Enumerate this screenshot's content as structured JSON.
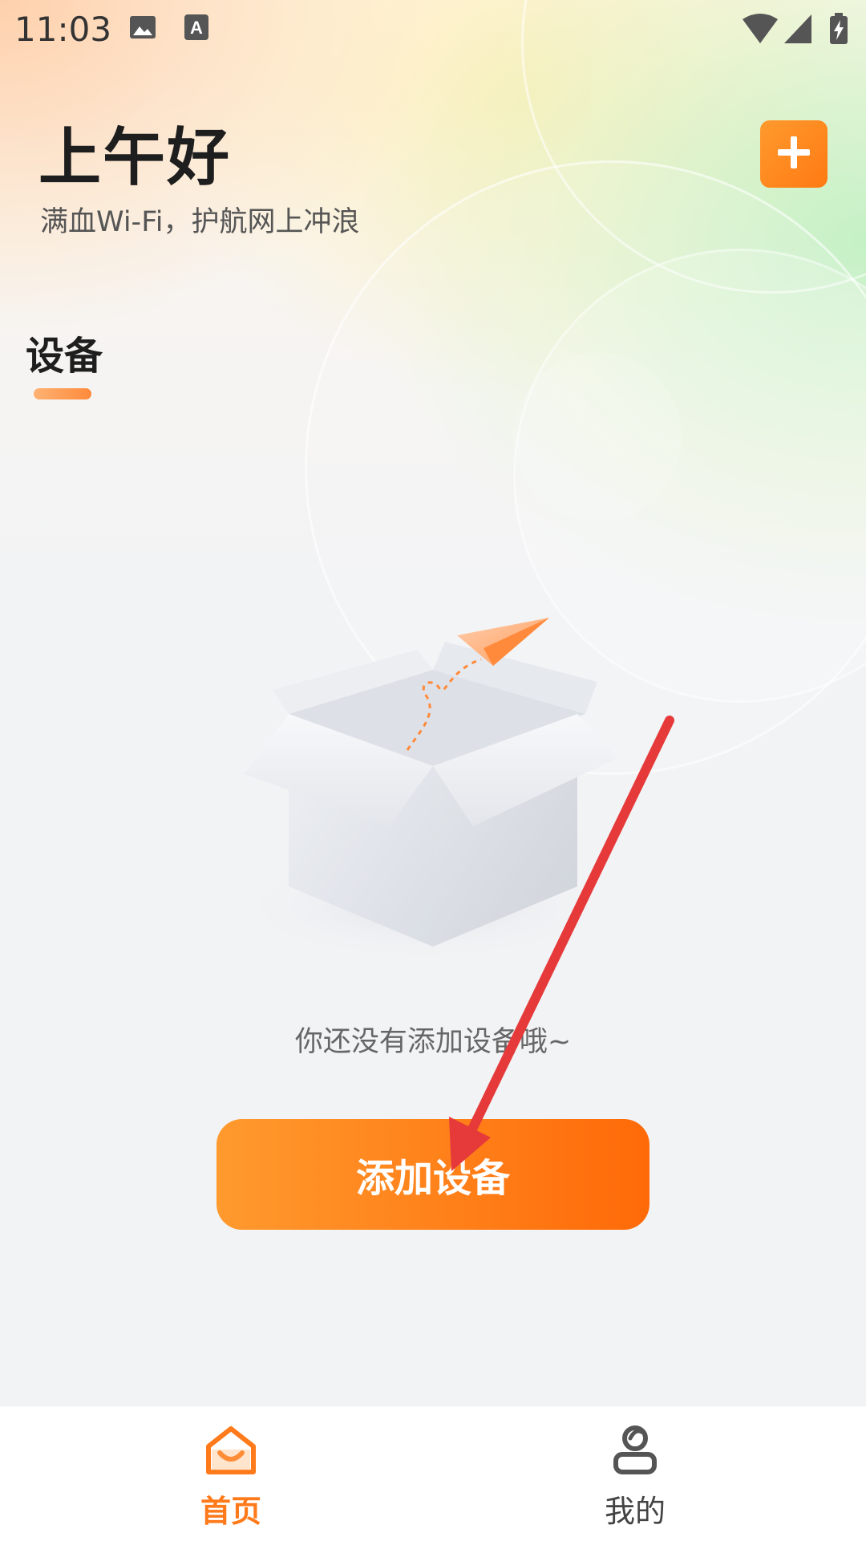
{
  "status_bar": {
    "time": "11:03",
    "icons": [
      "image-icon",
      "text-icon",
      "wifi-icon",
      "signal-icon",
      "battery-charging-icon"
    ]
  },
  "header": {
    "greeting": "上午好",
    "subtitle": "满血Wi-Fi，护航网上冲浪",
    "add_button_icon": "plus-icon"
  },
  "section_tab": {
    "label": "设备"
  },
  "empty_state": {
    "illustration": "open-box-with-paper-plane",
    "message": "你还没有添加设备哦~"
  },
  "primary_action": {
    "label": "添加设备"
  },
  "bottom_nav": {
    "items": [
      {
        "label": "首页",
        "icon": "home-icon",
        "active": true
      },
      {
        "label": "我的",
        "icon": "profile-icon",
        "active": false
      }
    ]
  },
  "colors": {
    "accent": "#ff7a1a",
    "button_gradient_start": "#ff9a2e",
    "button_gradient_end": "#ff6a08",
    "annotation_arrow": "#e63a3a"
  }
}
